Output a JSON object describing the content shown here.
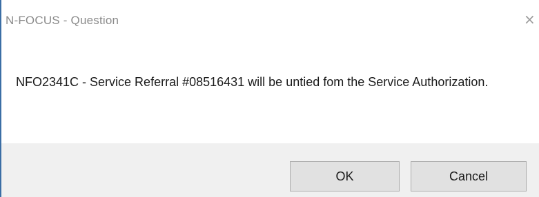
{
  "window": {
    "title": "N-FOCUS - Question",
    "close_symbol": "×"
  },
  "message": {
    "text": "NFO2341C - Service Referral #08516431 will be untied fom the Service Authorization."
  },
  "buttons": {
    "ok_label": "OK",
    "cancel_label": "Cancel"
  },
  "colors": {
    "accent_border": "#3b6ea5",
    "footer_background": "#f0f0f0",
    "button_background": "#e1e1e1",
    "title_text": "#8a8a8a"
  }
}
